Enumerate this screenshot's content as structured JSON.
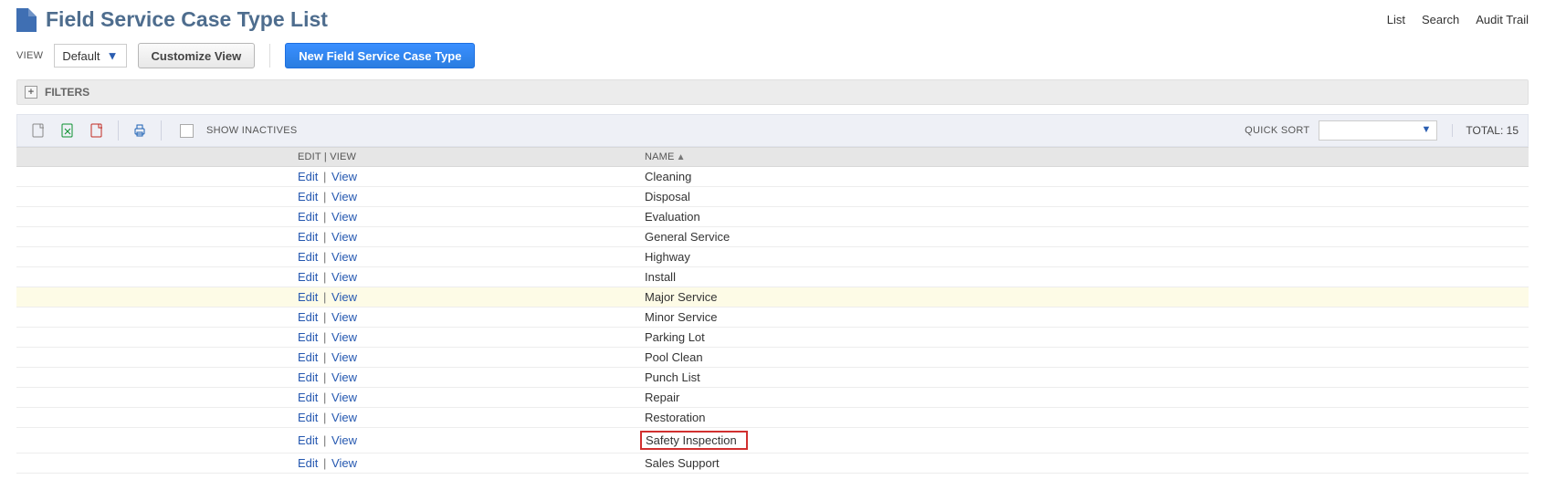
{
  "header": {
    "title": "Field Service Case Type List",
    "links": {
      "list": "List",
      "search": "Search",
      "audit": "Audit Trail"
    }
  },
  "toolbar": {
    "view_label": "VIEW",
    "view_value": "Default",
    "customize": "Customize View",
    "new": "New Field Service Case Type"
  },
  "filters": {
    "label": "FILTERS"
  },
  "list_toolbar": {
    "show_inactives": "SHOW INACTIVES",
    "quick_sort_label": "QUICK SORT",
    "quick_sort_value": "",
    "total_label": "TOTAL: 15"
  },
  "columns": {
    "edit_view": "EDIT | VIEW",
    "name": "NAME"
  },
  "row_actions": {
    "edit": "Edit",
    "view": "View"
  },
  "rows": [
    {
      "name": "Cleaning",
      "hl": false,
      "box": false
    },
    {
      "name": "Disposal",
      "hl": false,
      "box": false
    },
    {
      "name": "Evaluation",
      "hl": false,
      "box": false
    },
    {
      "name": "General Service",
      "hl": false,
      "box": false
    },
    {
      "name": "Highway",
      "hl": false,
      "box": false
    },
    {
      "name": "Install",
      "hl": false,
      "box": false
    },
    {
      "name": "Major Service",
      "hl": true,
      "box": false
    },
    {
      "name": "Minor Service",
      "hl": false,
      "box": false
    },
    {
      "name": "Parking Lot",
      "hl": false,
      "box": false
    },
    {
      "name": "Pool Clean",
      "hl": false,
      "box": false
    },
    {
      "name": "Punch List",
      "hl": false,
      "box": false
    },
    {
      "name": "Repair",
      "hl": false,
      "box": false
    },
    {
      "name": "Restoration",
      "hl": false,
      "box": false
    },
    {
      "name": "Safety Inspection",
      "hl": false,
      "box": true
    },
    {
      "name": "Sales Support",
      "hl": false,
      "box": false
    }
  ]
}
